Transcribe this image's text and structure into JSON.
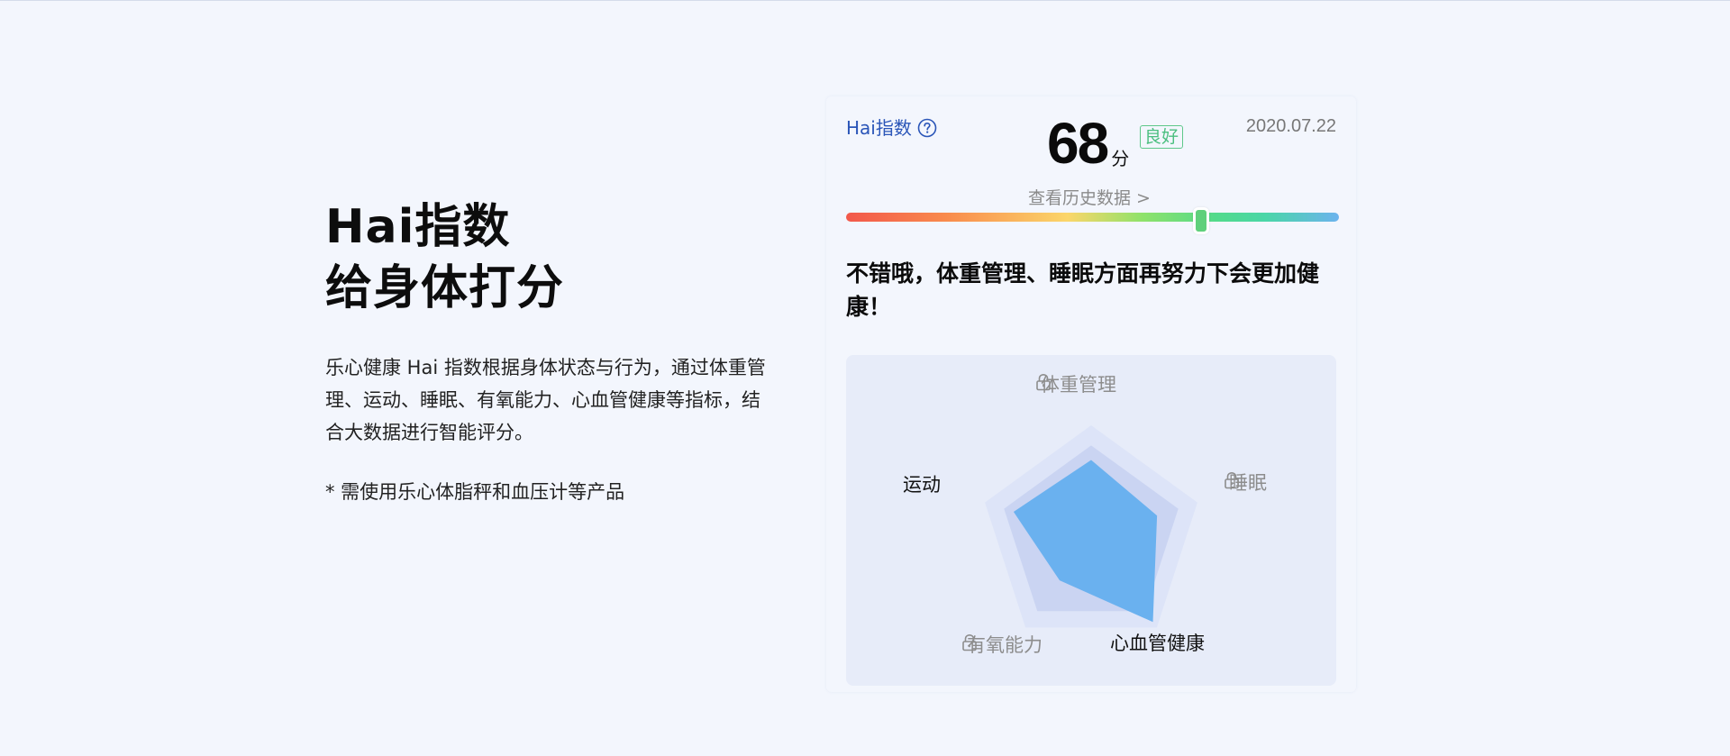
{
  "intro": {
    "title_line1": "Hai指数",
    "title_line2": "给身体打分",
    "description": "乐心健康 Hai 指数根据身体状态与行为，通过体重管理、运动、睡眠、有氧能力、心血管健康等指标，结合大数据进行智能评分。",
    "note": "* 需使用乐心体脂秤和血压计等产品"
  },
  "card": {
    "label": "Hai指数",
    "help_icon": "question-circle-icon",
    "score": "68",
    "score_unit": "分",
    "grade": "良好",
    "date": "2020.07.22",
    "history_link": "查看历史数据 >",
    "score_bar_level": 0.72,
    "summary": "不错哦，体重管理、睡眠方面再努力下会更加健康！",
    "radar": {
      "axes": [
        {
          "label": "体重管理",
          "locked": true
        },
        {
          "label": "睡眠",
          "locked": true
        },
        {
          "label": "心血管健康",
          "locked": false
        },
        {
          "label": "有氧能力",
          "locked": true
        },
        {
          "label": "运动",
          "locked": false
        }
      ],
      "values": [
        0.69,
        0.62,
        0.94,
        0.48,
        0.73
      ]
    }
  },
  "colors": {
    "accent_blue": "#2a55b8",
    "grade_green": "#4cbf80",
    "radar_fill": "#6ab1ef"
  }
}
